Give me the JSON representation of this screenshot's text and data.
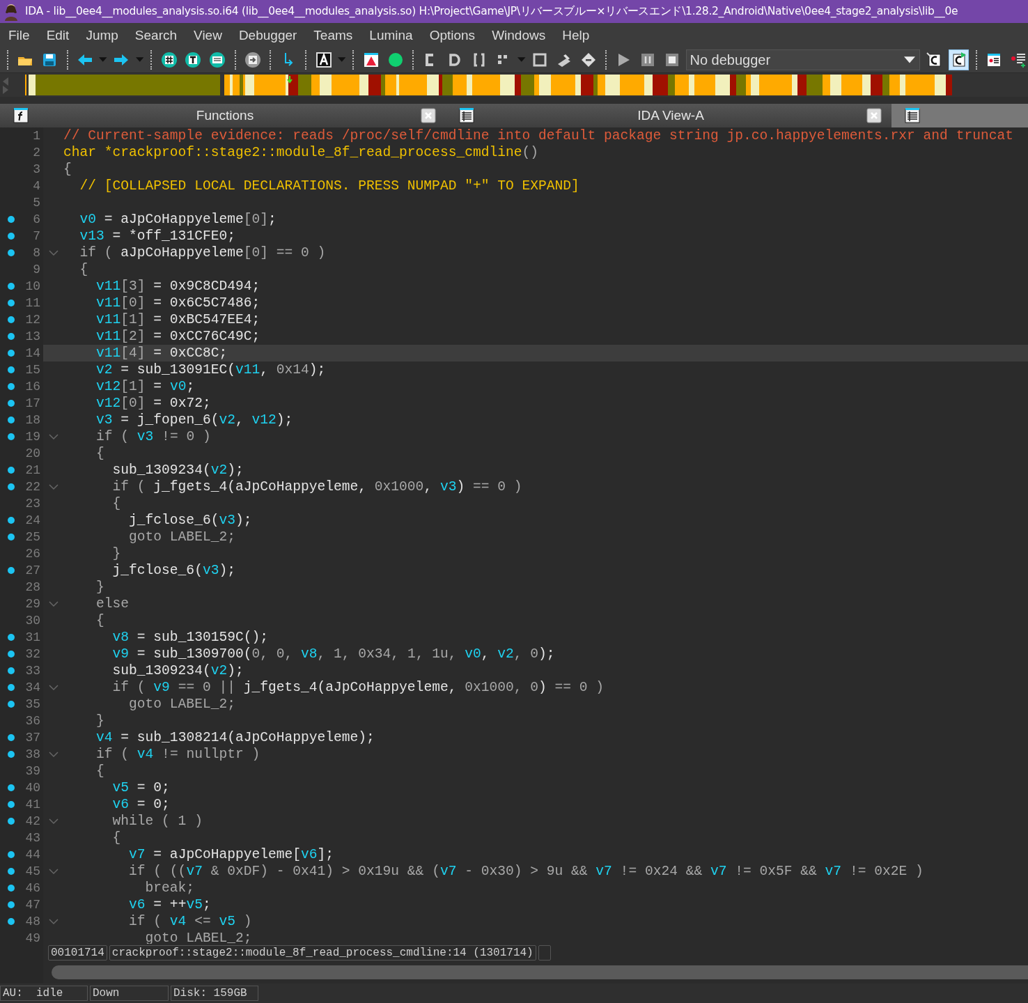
{
  "window": {
    "title": "IDA - lib__0ee4__modules_analysis.so.i64 (lib__0ee4__modules_analysis.so) H:\\Project\\Game\\JP\\リバースブルー×リバースエンド\\1.28.2_Android\\Native\\0ee4_stage2_analysis\\lib__0e"
  },
  "menu": [
    "File",
    "Edit",
    "Jump",
    "Search",
    "View",
    "Debugger",
    "Teams",
    "Lumina",
    "Options",
    "Windows",
    "Help"
  ],
  "toolbar": {
    "debugger": "No debugger",
    "toggles": [
      {
        "selected": false
      },
      {
        "selected": true
      }
    ]
  },
  "tabs": [
    {
      "kind": "functions",
      "label": "Functions",
      "selected": false,
      "closable": true
    },
    {
      "kind": "listing",
      "label": "IDA View-A",
      "selected": false,
      "closable": true
    },
    {
      "kind": "listing",
      "selected": true,
      "closable": false
    }
  ],
  "code": [
    {
      "n": "1",
      "dot": false,
      "fold": false,
      "current": false,
      "tokens": [
        {
          "kind": "comment",
          "t": "// Current-sample evidence: reads /proc/self/cmdline into default package string jp.co.happyelements.rxr and truncat"
        }
      ]
    },
    {
      "n": "2",
      "dot": false,
      "fold": false,
      "current": false,
      "tokens": [
        {
          "kind": "decl",
          "t": "char *crackproof::stage2::module_8f_read_process_cmdline"
        },
        {
          "kind": "keyword",
          "t": "()"
        }
      ]
    },
    {
      "n": "3",
      "dot": false,
      "fold": false,
      "current": false,
      "tokens": [
        {
          "kind": "keyword",
          "t": "{"
        }
      ]
    },
    {
      "n": "4",
      "dot": false,
      "fold": false,
      "current": false,
      "tokens": [
        {
          "kind": "decl",
          "t": "  // [COLLAPSED LOCAL DECLARATIONS. PRESS NUMPAD \"+\" TO EXPAND]"
        }
      ]
    },
    {
      "n": "5",
      "dot": false,
      "fold": false,
      "current": false
    },
    {
      "n": "6",
      "dot": true,
      "fold": false,
      "current": false,
      "tokens": [
        {
          "kind": "var",
          "t": "  v0"
        },
        {
          "kind": "name",
          "t": " = aJpCoHappyeleme"
        },
        {
          "kind": "keyword",
          "t": "[0]"
        },
        {
          "kind": "name",
          "t": ";"
        }
      ]
    },
    {
      "n": "7",
      "dot": true,
      "fold": false,
      "current": false,
      "tokens": [
        {
          "kind": "var",
          "t": "  v13"
        },
        {
          "kind": "name",
          "t": " = *off_131CFE0;"
        }
      ]
    },
    {
      "n": "8",
      "dot": true,
      "fold": true,
      "current": false,
      "tokens": [
        {
          "kind": "keyword",
          "t": "  if ( "
        },
        {
          "kind": "name",
          "t": "aJpCoHappyeleme"
        },
        {
          "kind": "keyword",
          "t": "[0] == 0 )"
        }
      ]
    },
    {
      "n": "9",
      "dot": false,
      "fold": false,
      "current": false,
      "tokens": [
        {
          "kind": "keyword",
          "t": "  {"
        }
      ]
    },
    {
      "n": "10",
      "dot": true,
      "fold": false,
      "current": false,
      "tokens": [
        {
          "kind": "var",
          "t": "    v11"
        },
        {
          "kind": "keyword",
          "t": "[3]"
        },
        {
          "kind": "name",
          "t": " = 0x9C8CD494;"
        }
      ]
    },
    {
      "n": "11",
      "dot": true,
      "fold": false,
      "current": false,
      "tokens": [
        {
          "kind": "var",
          "t": "    v11"
        },
        {
          "kind": "keyword",
          "t": "[0]"
        },
        {
          "kind": "name",
          "t": " = 0x6C5C7486;"
        }
      ]
    },
    {
      "n": "12",
      "dot": true,
      "fold": false,
      "current": false,
      "tokens": [
        {
          "kind": "var",
          "t": "    v11"
        },
        {
          "kind": "keyword",
          "t": "[1]"
        },
        {
          "kind": "name",
          "t": " = 0xBC547EE4;"
        }
      ]
    },
    {
      "n": "13",
      "dot": true,
      "fold": false,
      "current": false,
      "tokens": [
        {
          "kind": "var",
          "t": "    v11"
        },
        {
          "kind": "keyword",
          "t": "[2]"
        },
        {
          "kind": "name",
          "t": " = 0xCC76C49C;"
        }
      ]
    },
    {
      "n": "14",
      "dot": true,
      "fold": false,
      "current": true,
      "tokens": [
        {
          "kind": "var",
          "t": "    v11"
        },
        {
          "kind": "keyword",
          "t": "[4]"
        },
        {
          "kind": "name",
          "t": " = 0xCC8C;"
        }
      ]
    },
    {
      "n": "15",
      "dot": true,
      "fold": false,
      "current": false,
      "tokens": [
        {
          "kind": "var",
          "t": "    v2"
        },
        {
          "kind": "name",
          "t": " = sub_13091EC("
        },
        {
          "kind": "var",
          "t": "v11"
        },
        {
          "kind": "name",
          "t": ", "
        },
        {
          "kind": "keyword",
          "t": "0x14"
        },
        {
          "kind": "name",
          "t": ");"
        }
      ]
    },
    {
      "n": "16",
      "dot": true,
      "fold": false,
      "current": false,
      "tokens": [
        {
          "kind": "var",
          "t": "    v12"
        },
        {
          "kind": "keyword",
          "t": "[1]"
        },
        {
          "kind": "name",
          "t": " = "
        },
        {
          "kind": "var",
          "t": "v0"
        },
        {
          "kind": "name",
          "t": ";"
        }
      ]
    },
    {
      "n": "17",
      "dot": true,
      "fold": false,
      "current": false,
      "tokens": [
        {
          "kind": "var",
          "t": "    v12"
        },
        {
          "kind": "keyword",
          "t": "[0]"
        },
        {
          "kind": "name",
          "t": " = 0x72;"
        }
      ]
    },
    {
      "n": "18",
      "dot": true,
      "fold": false,
      "current": false,
      "tokens": [
        {
          "kind": "var",
          "t": "    v3"
        },
        {
          "kind": "name",
          "t": " = j_fopen_6("
        },
        {
          "kind": "var",
          "t": "v2"
        },
        {
          "kind": "name",
          "t": ", "
        },
        {
          "kind": "var",
          "t": "v12"
        },
        {
          "kind": "name",
          "t": ");"
        }
      ]
    },
    {
      "n": "19",
      "dot": true,
      "fold": true,
      "current": false,
      "tokens": [
        {
          "kind": "keyword",
          "t": "    if ( "
        },
        {
          "kind": "var",
          "t": "v3"
        },
        {
          "kind": "keyword",
          "t": " != 0 )"
        }
      ]
    },
    {
      "n": "20",
      "dot": false,
      "fold": false,
      "current": false,
      "tokens": [
        {
          "kind": "keyword",
          "t": "    {"
        }
      ]
    },
    {
      "n": "21",
      "dot": true,
      "fold": false,
      "current": false,
      "tokens": [
        {
          "kind": "name",
          "t": "      sub_1309234("
        },
        {
          "kind": "var",
          "t": "v2"
        },
        {
          "kind": "name",
          "t": ");"
        }
      ]
    },
    {
      "n": "22",
      "dot": true,
      "fold": true,
      "current": false,
      "tokens": [
        {
          "kind": "keyword",
          "t": "      if ( "
        },
        {
          "kind": "name",
          "t": "j_fgets_4(aJpCoHappyeleme, "
        },
        {
          "kind": "keyword",
          "t": "0x1000"
        },
        {
          "kind": "name",
          "t": ", "
        },
        {
          "kind": "var",
          "t": "v3"
        },
        {
          "kind": "name",
          "t": ")"
        },
        {
          "kind": "keyword",
          "t": " == 0 )"
        }
      ]
    },
    {
      "n": "23",
      "dot": false,
      "fold": false,
      "current": false,
      "tokens": [
        {
          "kind": "keyword",
          "t": "      {"
        }
      ]
    },
    {
      "n": "24",
      "dot": true,
      "fold": false,
      "current": false,
      "tokens": [
        {
          "kind": "name",
          "t": "        j_fclose_6("
        },
        {
          "kind": "var",
          "t": "v3"
        },
        {
          "kind": "name",
          "t": ");"
        }
      ]
    },
    {
      "n": "25",
      "dot": true,
      "fold": false,
      "current": false,
      "tokens": [
        {
          "kind": "keyword",
          "t": "        goto LABEL_2;"
        }
      ]
    },
    {
      "n": "26",
      "dot": false,
      "fold": false,
      "current": false,
      "tokens": [
        {
          "kind": "keyword",
          "t": "      }"
        }
      ]
    },
    {
      "n": "27",
      "dot": true,
      "fold": false,
      "current": false,
      "tokens": [
        {
          "kind": "name",
          "t": "      j_fclose_6("
        },
        {
          "kind": "var",
          "t": "v3"
        },
        {
          "kind": "name",
          "t": ");"
        }
      ]
    },
    {
      "n": "28",
      "dot": false,
      "fold": false,
      "current": false,
      "tokens": [
        {
          "kind": "keyword",
          "t": "    }"
        }
      ]
    },
    {
      "n": "29",
      "dot": false,
      "fold": true,
      "current": false,
      "tokens": [
        {
          "kind": "keyword",
          "t": "    else"
        }
      ]
    },
    {
      "n": "30",
      "dot": false,
      "fold": false,
      "current": false,
      "tokens": [
        {
          "kind": "keyword",
          "t": "    {"
        }
      ]
    },
    {
      "n": "31",
      "dot": true,
      "fold": false,
      "current": false,
      "tokens": [
        {
          "kind": "var",
          "t": "      v8"
        },
        {
          "kind": "name",
          "t": " = sub_130159C();"
        }
      ]
    },
    {
      "n": "32",
      "dot": true,
      "fold": false,
      "current": false,
      "tokens": [
        {
          "kind": "var",
          "t": "      v9"
        },
        {
          "kind": "name",
          "t": " = sub_1309700("
        },
        {
          "kind": "keyword",
          "t": "0, 0, "
        },
        {
          "kind": "var",
          "t": "v8"
        },
        {
          "kind": "keyword",
          "t": ", 1, 0x34, 1, 1u, "
        },
        {
          "kind": "var",
          "t": "v0"
        },
        {
          "kind": "name",
          "t": ", "
        },
        {
          "kind": "var",
          "t": "v2"
        },
        {
          "kind": "keyword",
          "t": ", 0"
        },
        {
          "kind": "name",
          "t": ");"
        }
      ]
    },
    {
      "n": "33",
      "dot": true,
      "fold": false,
      "current": false,
      "tokens": [
        {
          "kind": "name",
          "t": "      sub_1309234("
        },
        {
          "kind": "var",
          "t": "v2"
        },
        {
          "kind": "name",
          "t": ");"
        }
      ]
    },
    {
      "n": "34",
      "dot": true,
      "fold": true,
      "current": false,
      "tokens": [
        {
          "kind": "keyword",
          "t": "      if ( "
        },
        {
          "kind": "var",
          "t": "v9"
        },
        {
          "kind": "keyword",
          "t": " == 0 || "
        },
        {
          "kind": "name",
          "t": "j_fgets_4(aJpCoHappyeleme, "
        },
        {
          "kind": "keyword",
          "t": "0x1000, 0"
        },
        {
          "kind": "name",
          "t": ")"
        },
        {
          "kind": "keyword",
          "t": " == 0 )"
        }
      ]
    },
    {
      "n": "35",
      "dot": true,
      "fold": false,
      "current": false,
      "tokens": [
        {
          "kind": "keyword",
          "t": "        goto LABEL_2;"
        }
      ]
    },
    {
      "n": "36",
      "dot": false,
      "fold": false,
      "current": false,
      "tokens": [
        {
          "kind": "keyword",
          "t": "    }"
        }
      ]
    },
    {
      "n": "37",
      "dot": true,
      "fold": false,
      "current": false,
      "tokens": [
        {
          "kind": "var",
          "t": "    v4"
        },
        {
          "kind": "name",
          "t": " = sub_1308214(aJpCoHappyeleme);"
        }
      ]
    },
    {
      "n": "38",
      "dot": true,
      "fold": true,
      "current": false,
      "tokens": [
        {
          "kind": "keyword",
          "t": "    if ( "
        },
        {
          "kind": "var",
          "t": "v4"
        },
        {
          "kind": "keyword",
          "t": " != nullptr )"
        }
      ]
    },
    {
      "n": "39",
      "dot": false,
      "fold": false,
      "current": false,
      "tokens": [
        {
          "kind": "keyword",
          "t": "    {"
        }
      ]
    },
    {
      "n": "40",
      "dot": true,
      "fold": false,
      "current": false,
      "tokens": [
        {
          "kind": "var",
          "t": "      v5"
        },
        {
          "kind": "name",
          "t": " = 0;"
        }
      ]
    },
    {
      "n": "41",
      "dot": true,
      "fold": false,
      "current": false,
      "tokens": [
        {
          "kind": "var",
          "t": "      v6"
        },
        {
          "kind": "name",
          "t": " = 0;"
        }
      ]
    },
    {
      "n": "42",
      "dot": true,
      "fold": true,
      "current": false,
      "tokens": [
        {
          "kind": "keyword",
          "t": "      while ( 1 )"
        }
      ]
    },
    {
      "n": "43",
      "dot": false,
      "fold": false,
      "current": false,
      "tokens": [
        {
          "kind": "keyword",
          "t": "      {"
        }
      ]
    },
    {
      "n": "44",
      "dot": true,
      "fold": false,
      "current": false,
      "tokens": [
        {
          "kind": "var",
          "t": "        v7"
        },
        {
          "kind": "name",
          "t": " = aJpCoHappyeleme["
        },
        {
          "kind": "var",
          "t": "v6"
        },
        {
          "kind": "name",
          "t": "];"
        }
      ]
    },
    {
      "n": "45",
      "dot": true,
      "fold": true,
      "current": false,
      "tokens": [
        {
          "kind": "keyword",
          "t": "        if ( (("
        },
        {
          "kind": "var",
          "t": "v7"
        },
        {
          "kind": "keyword",
          "t": " & 0xDF) - 0x41) > 0x19u && ("
        },
        {
          "kind": "var",
          "t": "v7"
        },
        {
          "kind": "keyword",
          "t": " - 0x30) > 9u && "
        },
        {
          "kind": "var",
          "t": "v7"
        },
        {
          "kind": "keyword",
          "t": " != 0x24 && "
        },
        {
          "kind": "var",
          "t": "v7"
        },
        {
          "kind": "keyword",
          "t": " != 0x5F && "
        },
        {
          "kind": "var",
          "t": "v7"
        },
        {
          "kind": "keyword",
          "t": " != 0x2E )"
        }
      ]
    },
    {
      "n": "46",
      "dot": true,
      "fold": false,
      "current": false,
      "tokens": [
        {
          "kind": "keyword",
          "t": "          break;"
        }
      ]
    },
    {
      "n": "47",
      "dot": true,
      "fold": false,
      "current": false,
      "tokens": [
        {
          "kind": "var",
          "t": "        v6"
        },
        {
          "kind": "name",
          "t": " = ++"
        },
        {
          "kind": "var",
          "t": "v5"
        },
        {
          "kind": "name",
          "t": ";"
        }
      ]
    },
    {
      "n": "48",
      "dot": true,
      "fold": true,
      "current": false,
      "tokens": [
        {
          "kind": "keyword",
          "t": "        if ( "
        },
        {
          "kind": "var",
          "t": "v4"
        },
        {
          "kind": "keyword",
          "t": " <= "
        },
        {
          "kind": "var",
          "t": "v5"
        },
        {
          "kind": "keyword",
          "t": " )"
        }
      ]
    },
    {
      "n": "49",
      "dot": false,
      "fold": false,
      "current": false,
      "tokens": [
        {
          "kind": "keyword",
          "t": "          goto LABEL_2;"
        }
      ]
    }
  ],
  "location": {
    "address": "00101714",
    "function": "crackproof::stage2::module_8f_read_process_cmdline:14 (1301714)"
  },
  "status_bar": [
    "AU:  idle",
    "Down",
    "Disk: 159GB"
  ]
}
